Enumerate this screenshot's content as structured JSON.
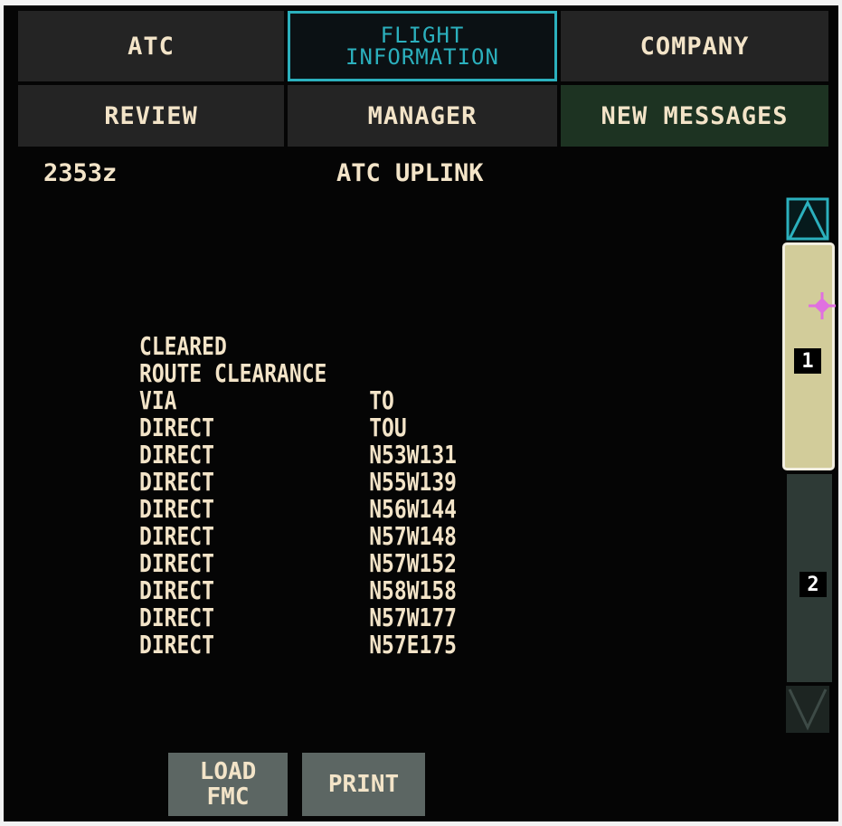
{
  "tabs_row1": [
    {
      "label": "ATC"
    },
    {
      "label_line1": "FLIGHT",
      "label_line2": "INFORMATION"
    },
    {
      "label": "COMPANY"
    }
  ],
  "tabs_row2": [
    {
      "label": "REVIEW"
    },
    {
      "label": "MANAGER"
    },
    {
      "label": "NEW MESSAGES"
    }
  ],
  "header": {
    "time": "2353z",
    "title": "ATC UPLINK"
  },
  "message": {
    "lines": [
      {
        "c1": "CLEARED",
        "c2": ""
      },
      {
        "c1": "ROUTE CLEARANCE",
        "c2": ""
      },
      {
        "c1": "VIA",
        "c2": "TO"
      },
      {
        "c1": "DIRECT",
        "c2": "TOU"
      },
      {
        "c1": "DIRECT",
        "c2": "N53W131"
      },
      {
        "c1": "DIRECT",
        "c2": "N55W139"
      },
      {
        "c1": "DIRECT",
        "c2": "N56W144"
      },
      {
        "c1": "DIRECT",
        "c2": "N57W148"
      },
      {
        "c1": "DIRECT",
        "c2": "N57W152"
      },
      {
        "c1": "DIRECT",
        "c2": "N58W158"
      },
      {
        "c1": "DIRECT",
        "c2": "N57W177"
      },
      {
        "c1": "DIRECT",
        "c2": "N57E175"
      }
    ]
  },
  "scrollbar": {
    "page1": "1",
    "page2": "2",
    "position_icon": "magenta-crosshair-icon",
    "colors": {
      "thumb": "#d2cc9a",
      "up_arrow": "#2bb0bd",
      "marker": "#e070e0"
    }
  },
  "buttons": {
    "load_line1": "LOAD",
    "load_line2": "FMC",
    "print": "PRINT"
  },
  "colors": {
    "text": "#f3e4c8",
    "selected_tab": "#2bb0bd",
    "tab_bg": "#242424",
    "new_messages_bg": "#1d3322",
    "button_bg": "#5c6663"
  }
}
